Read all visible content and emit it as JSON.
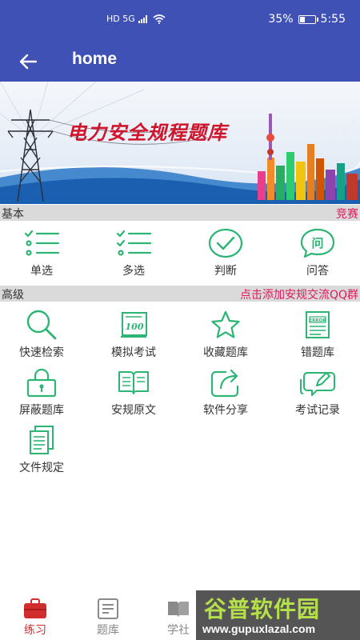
{
  "status_bar": {
    "network": "HD 5G",
    "battery": "35%",
    "battery_level": 0.35,
    "time": "5:55"
  },
  "app_bar": {
    "title": "home",
    "back_icon": "arrow-left-icon"
  },
  "banner": {
    "title": "电力安全规程题库"
  },
  "colors": {
    "primary": "#3f51b5",
    "accent_green": "#2cb573",
    "link_pink": "#e0195a",
    "nav_active": "#d22d2d"
  },
  "basic_section": {
    "label": "基本",
    "link": "竞赛",
    "items": [
      {
        "label": "单选",
        "icon": "single-choice-icon"
      },
      {
        "label": "多选",
        "icon": "multi-choice-icon"
      },
      {
        "label": "判断",
        "icon": "check-circle-icon"
      },
      {
        "label": "问答",
        "icon": "qa-bubble-icon"
      }
    ]
  },
  "advanced_section": {
    "label": "高级",
    "link": "点击添加安规交流QQ群",
    "items": [
      {
        "label": "快速检索",
        "icon": "search-icon"
      },
      {
        "label": "模拟考试",
        "icon": "exam-100-icon"
      },
      {
        "label": "收藏题库",
        "icon": "star-icon"
      },
      {
        "label": "错题库",
        "icon": "error-doc-icon"
      },
      {
        "label": "屏蔽题库",
        "icon": "lock-icon"
      },
      {
        "label": "安规原文",
        "icon": "open-book-icon"
      },
      {
        "label": "软件分享",
        "icon": "share-icon"
      },
      {
        "label": "考试记录",
        "icon": "record-edit-icon"
      },
      {
        "label": "文件规定",
        "icon": "documents-icon"
      }
    ]
  },
  "bottom_nav": {
    "items": [
      {
        "label": "练习",
        "icon": "practice-bag-icon",
        "active": true
      },
      {
        "label": "题库",
        "icon": "question-bank-icon",
        "active": false
      },
      {
        "label": "学社",
        "icon": "book-icon",
        "active": false
      }
    ]
  },
  "watermark": {
    "top": "谷普软件园",
    "bottom": "www.gupuxlazal.com"
  }
}
